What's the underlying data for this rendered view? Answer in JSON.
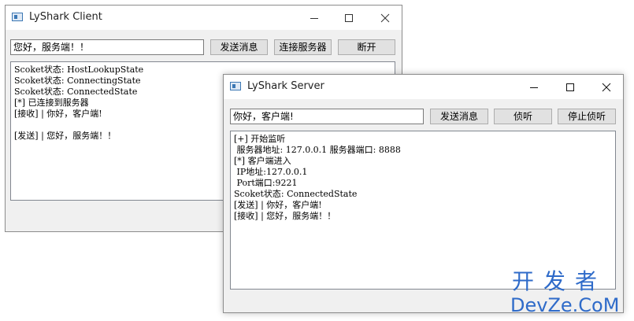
{
  "client": {
    "title": "LyShark Client",
    "message_input": "您好，服务端！！",
    "send_button": "发送消息",
    "connect_button": "连接服务器",
    "disconnect_button": "断开",
    "log": [
      "Scoket状态: HostLookupState",
      "Scoket状态: ConnectingState",
      "Scoket状态: ConnectedState",
      "[*] 已连接到服务器",
      "[接收] | 你好，客户端!",
      "",
      "[发送] | 您好，服务端！！"
    ]
  },
  "server": {
    "title": "LyShark Server",
    "message_input": "你好，客户端!",
    "send_button": "发送消息",
    "listen_button": "侦听",
    "stop_button": "停止侦听",
    "log": [
      "[+] 开始监听",
      " 服务器地址: 127.0.0.1 服务器端口: 8888",
      "[*] 客户端进入",
      " IP地址:127.0.0.1",
      " Port端口:9221",
      "Scoket状态: ConnectedState",
      "[发送] | 你好，客户端!",
      "[接收] | 您好，服务端！！"
    ]
  },
  "watermark": {
    "chinese": "开发者",
    "latin": "DevZe.CoM"
  },
  "colors": {
    "watermark": "#2f6bc9",
    "titlebar": "#ffffff",
    "window_body": "#f0f0f0",
    "button_face": "#e1e1e1"
  }
}
